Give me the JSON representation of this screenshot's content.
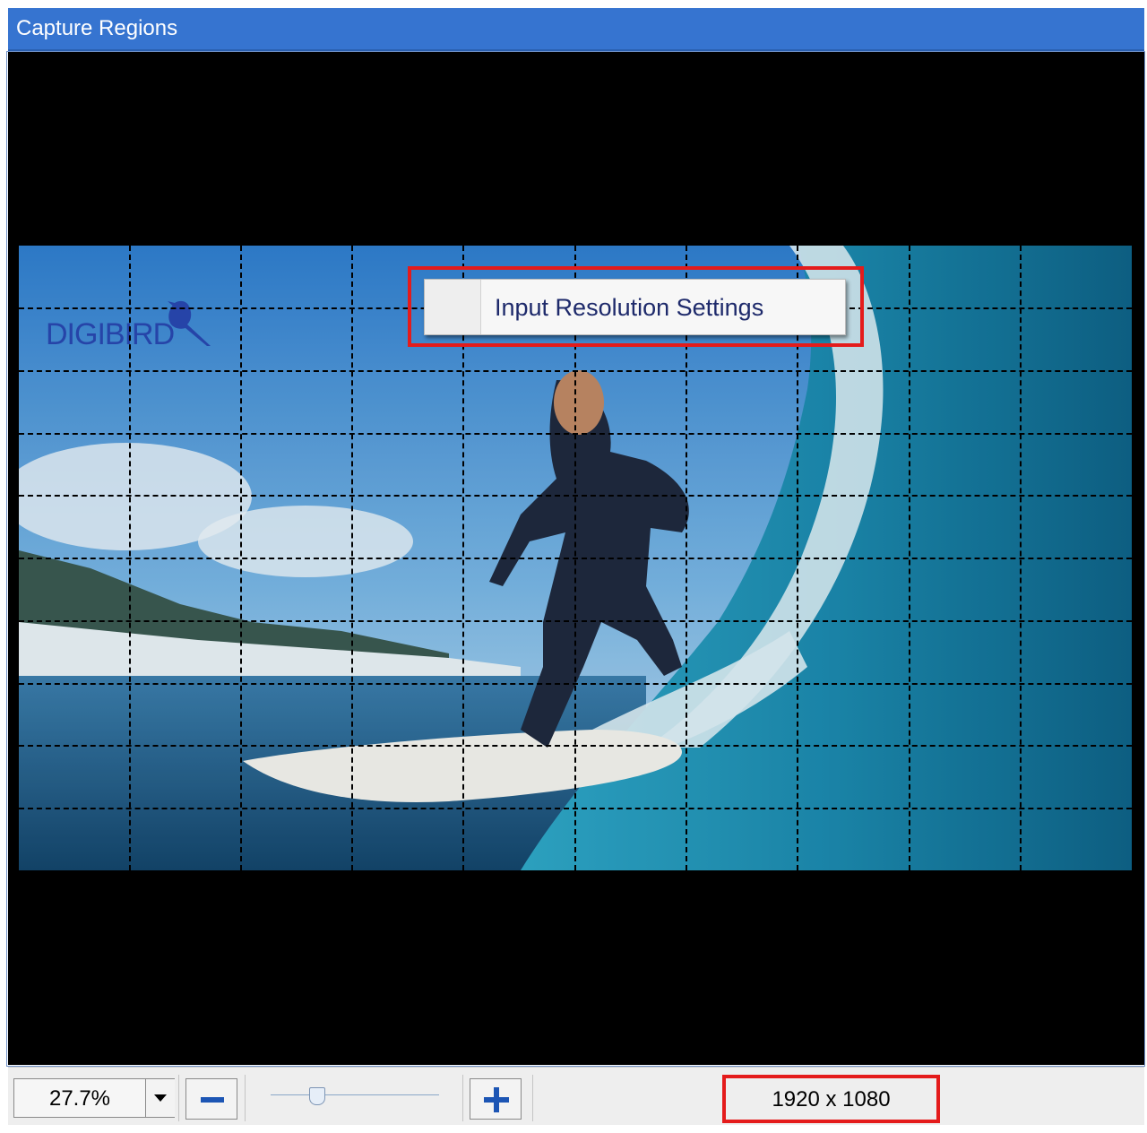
{
  "window": {
    "title": "Capture Regions"
  },
  "preview": {
    "logo_text": "DIGIBIRD",
    "grid": {
      "columns": 10,
      "rows": 10
    }
  },
  "context_menu": {
    "items": [
      {
        "label": "Input Resolution Settings"
      }
    ]
  },
  "statusbar": {
    "zoom_value": "27.7%",
    "zoom_slider_level": 0.25,
    "resolution": "1920 x 1080"
  },
  "colors": {
    "title_bar": "#3674d0",
    "highlight": "#e41b1b",
    "icon_blue": "#1c55b4"
  },
  "icons": {
    "zoom_dropdown": "chevron-down-icon",
    "zoom_out": "minus-icon",
    "zoom_in": "plus-icon",
    "logo": "bird-icon"
  }
}
